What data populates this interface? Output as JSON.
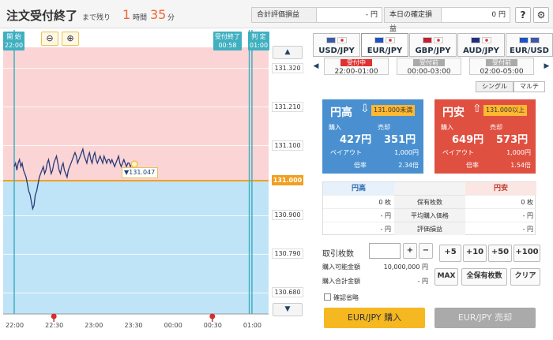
{
  "header": {
    "status": "注文受付終了",
    "remain_label": "まで残り",
    "hours": "1",
    "hours_unit": "時間",
    "minutes": "35",
    "minutes_unit": "分",
    "eval_label": "合計評価損益",
    "eval_value": "- 円",
    "today_label": "本日の確定損益",
    "today_value": "0 円",
    "help_icon_glyph": "?",
    "gear_icon_glyph": "⚙"
  },
  "chart": {
    "start_label": "開 始",
    "start_time": "22:00",
    "end_accept_label": "受付終了",
    "end_accept_time": "00:58",
    "judge_label": "判 定",
    "judge_time": "01:00",
    "zoom_out_glyph": "⊖",
    "zoom_in_glyph": "⊕",
    "scroll_up_glyph": "▲",
    "scroll_down_glyph": "▼",
    "current_price_tag": "▼131.047",
    "colors": {
      "upper_zone": "#fbd5d5",
      "lower_zone": "#bfe3f7",
      "strike_line": "#f0a020",
      "time_line": "#40b0c0",
      "price_line": "#2a3a7a"
    }
  },
  "chart_data": {
    "type": "line",
    "x": [
      "22:00",
      "22:01",
      "22:02",
      "22:03",
      "22:04",
      "22:05",
      "22:06",
      "22:07",
      "22:08",
      "22:09",
      "22:10",
      "22:11",
      "22:12",
      "22:13",
      "22:14",
      "22:15",
      "22:16",
      "22:17",
      "22:18",
      "22:19",
      "22:20",
      "22:21",
      "22:22",
      "22:23",
      "22:24",
      "22:25",
      "22:26",
      "22:27",
      "22:28",
      "22:29",
      "22:30",
      "22:31",
      "22:32",
      "22:33",
      "22:34",
      "22:35",
      "22:36",
      "22:37",
      "22:38",
      "22:39",
      "22:40",
      "22:41",
      "22:42",
      "22:43",
      "22:44",
      "22:45",
      "22:46",
      "22:47",
      "22:48",
      "22:49",
      "22:50",
      "22:51",
      "22:52",
      "22:53",
      "22:54",
      "22:55",
      "22:56",
      "22:57",
      "22:58",
      "22:59",
      "23:00",
      "23:01",
      "23:02",
      "23:03",
      "23:04",
      "23:05",
      "23:06",
      "23:07",
      "23:08",
      "23:09",
      "23:10",
      "23:11",
      "23:12",
      "23:13",
      "23:14",
      "23:15",
      "23:16",
      "23:17",
      "23:18",
      "23:19",
      "23:20",
      "23:21",
      "23:22",
      "23:23",
      "23:24",
      "23:25",
      "23:26",
      "23:27",
      "23:28",
      "23:29",
      "23:30",
      "23:31"
    ],
    "values": [
      131.04,
      131.05,
      131.03,
      131.05,
      131.06,
      131.04,
      131.05,
      131.03,
      131.02,
      131.01,
      130.99,
      130.97,
      130.96,
      130.94,
      130.92,
      130.93,
      130.96,
      130.97,
      130.99,
      131.01,
      131.02,
      131.03,
      131.04,
      131.02,
      131.03,
      131.05,
      131.06,
      131.04,
      131.02,
      131.03,
      131.05,
      131.06,
      131.07,
      131.05,
      131.03,
      131.02,
      131.04,
      131.05,
      131.03,
      131.02,
      131.01,
      131.03,
      131.04,
      131.05,
      131.06,
      131.07,
      131.08,
      131.07,
      131.05,
      131.06,
      131.07,
      131.08,
      131.09,
      131.07,
      131.06,
      131.05,
      131.07,
      131.08,
      131.06,
      131.05,
      131.07,
      131.08,
      131.06,
      131.05,
      131.06,
      131.07,
      131.06,
      131.05,
      131.07,
      131.06,
      131.05,
      131.06,
      131.06,
      131.05,
      131.06,
      131.05,
      131.04,
      131.05,
      131.06,
      131.07,
      131.05,
      131.04,
      131.05,
      131.06,
      131.05,
      131.04,
      131.05,
      131.05,
      131.04,
      131.05,
      131.05,
      131.047
    ],
    "strike": 131.0,
    "current": 131.047,
    "ylim": [
      130.62,
      131.38
    ],
    "y_ticks": [
      "131.320",
      "131.210",
      "131.100",
      "131.000",
      "130.900",
      "130.790",
      "130.680"
    ],
    "x_ticks": [
      "22:00",
      "22:30",
      "23:00",
      "23:30",
      "00:00",
      "00:30",
      "01:00"
    ],
    "marker_times": [
      "22:30",
      "00:30"
    ]
  },
  "currency_tabs": [
    {
      "label": "USD/JPY",
      "active": false
    },
    {
      "label": "EUR/JPY",
      "active": true
    },
    {
      "label": "GBP/JPY",
      "active": false
    },
    {
      "label": "AUD/JPY",
      "active": false
    },
    {
      "label": "EUR/USD",
      "active": false
    }
  ],
  "sessions": [
    {
      "state": "受付中",
      "time": "22:00-01:00",
      "active": true
    },
    {
      "state": "受付前",
      "time": "00:00-03:00",
      "active": false
    },
    {
      "state": "受付前",
      "time": "02:00-05:00",
      "active": false
    }
  ],
  "mode": {
    "single": "シングル",
    "multi": "マルチ"
  },
  "high_card": {
    "name": "円高",
    "arrow": "⇩",
    "condition": "131.000未満",
    "buy_label": "購入",
    "buy_value": "427円",
    "sell_label": "売却",
    "sell_value": "351円",
    "payout_label": "ペイアウト",
    "payout_value": "1,000円",
    "rate_label": "倍率",
    "rate_value": "2.34倍"
  },
  "low_card": {
    "name": "円安",
    "arrow": "⇧",
    "condition": "131.000以上",
    "buy_label": "購入",
    "buy_value": "649円",
    "sell_label": "売却",
    "sell_value": "573円",
    "payout_label": "ペイアウト",
    "payout_value": "1,000円",
    "rate_label": "倍率",
    "rate_value": "1.54倍"
  },
  "positions": {
    "high_header": "円高",
    "low_header": "円安",
    "rows": [
      {
        "label": "保有枚数",
        "high": "0 枚",
        "low": "0 枚"
      },
      {
        "label": "平均購入価格",
        "high": "- 円",
        "low": "- 円"
      },
      {
        "label": "評価損益",
        "high": "- 円",
        "low": "- 円"
      }
    ]
  },
  "order": {
    "qty_label": "取引枚数",
    "plus_glyph": "+",
    "minus_glyph": "−",
    "quick_add": [
      "+5",
      "+10",
      "+50",
      "+100"
    ],
    "max_label": "MAX",
    "all_positions_label": "全保有枚数",
    "clear_label": "クリア",
    "available_label": "購入可能金額",
    "available_value": "10,000,000 円",
    "total_label": "購入合計金額",
    "total_value": "- 円",
    "confirm_skip_label": "確認省略",
    "buy_button": "EUR/JPY 購入",
    "sell_button": "EUR/JPY 売却"
  }
}
